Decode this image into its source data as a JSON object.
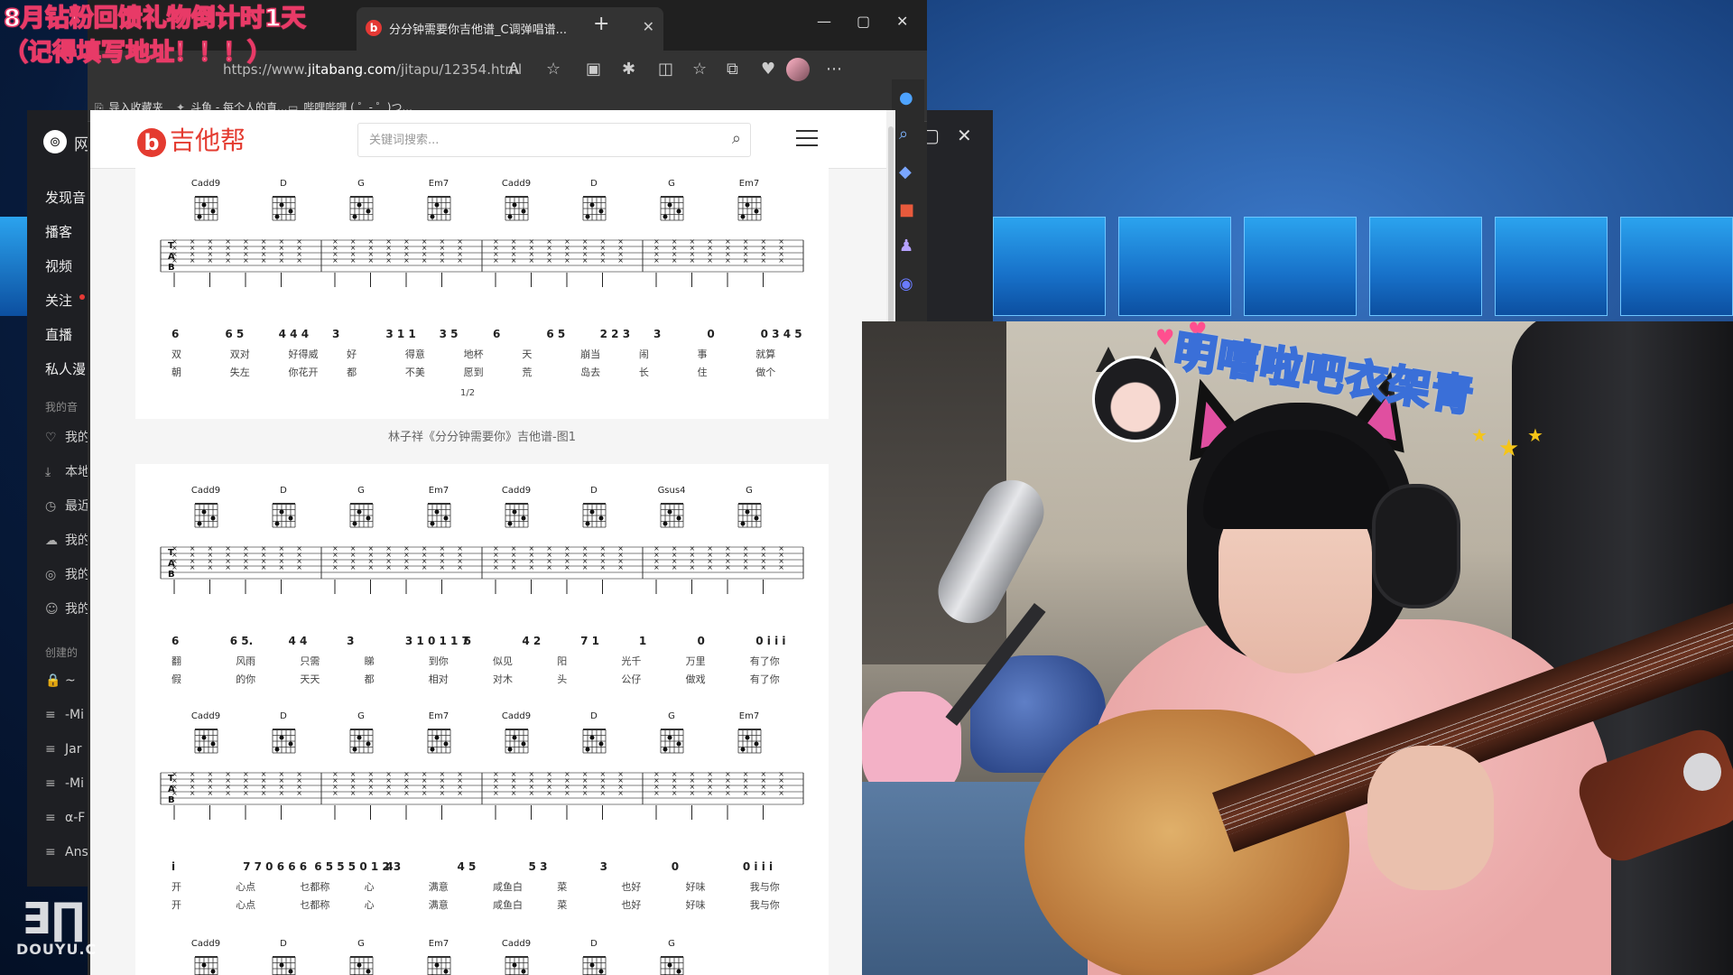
{
  "overlay": {
    "announce_line1": "8月钻粉回馈礼物倒计时1天",
    "announce_line2": "（记得填写地址！！！）",
    "streamer_label": "明嘻啦吧衣架青",
    "watermark": "DOUYU.C"
  },
  "browser": {
    "tab_title": "分分钟需要你吉他谱_C调弹唱谱...",
    "url_prefix": "https://www.",
    "url_host": "jitabang.com",
    "url_path": "/jitapu/12354.html",
    "favorites": [
      "导入收藏夹",
      "斗鱼 - 每个人的直...",
      "哔哩哔哩 ( ゜- ゜)つ..."
    ]
  },
  "site": {
    "logo_text": "吉他帮",
    "search_placeholder": "关键词搜索..."
  },
  "sheet1": {
    "chords": [
      "Cadd9",
      "D",
      "G",
      "Em7",
      "Cadd9",
      "D",
      "G",
      "Em7"
    ],
    "notes": [
      "6",
      "6 5",
      "4 4 4",
      "3",
      "3 1 1",
      "3 5",
      "6",
      "6 5",
      "2 2 3",
      "3",
      "0",
      "0 3 4 5"
    ],
    "lyrics1": "双 双对 好得威 好 得意 地杯 天 崩当 闹 事 就算",
    "lyrics2": "朝 失左 你花开 都 不美 愿到 荒 岛去 长 住 做个",
    "page_marker": "1/2",
    "caption": "林子祥《分分钟需要你》吉他谱-图1"
  },
  "sheet2": {
    "chords_row1": [
      "Cadd9",
      "D",
      "G",
      "Em7",
      "Cadd9",
      "D",
      "Gsus4",
      "G"
    ],
    "notes_row1": [
      "6",
      "6 5.",
      "4 4",
      "3",
      "3 1 0 1 1 7",
      "6",
      "4 2",
      "7 1",
      "1",
      "0",
      "0 i i i"
    ],
    "lyrics_row1a": "翻 风雨 只需 睇 到你 似见 阳 光千 万里 有了你",
    "lyrics_row1b": "假 的你 天天 都 相对 对木 头 公仔 做戏 有了你",
    "chords_row2": [
      "Cadd9",
      "D",
      "G",
      "Em7",
      "Cadd9",
      "D",
      "G",
      "Em7"
    ],
    "notes_row2": [
      "i",
      "7 7 0 6 6 6",
      "6 5 5 5 0 1 2 3",
      "4",
      "4 5",
      "5 3",
      "3",
      "0",
      "0 i i i"
    ],
    "lyrics_row2a": "开 心点 乜都称 心 满意 咸鱼白 菜 也好 好味 我与你",
    "lyrics_row2b": "开 心点 乜都称 心 满意 咸鱼白 菜 也好 好味 我与你",
    "chords_row3": [
      "Cadd9",
      "D",
      "G",
      "Em7",
      "Cadd9",
      "D",
      "G"
    ]
  },
  "music_app": {
    "title": "网",
    "nav": [
      "发现音",
      "播客",
      "视频",
      "关注",
      "直播",
      "私人漫"
    ],
    "section_mine": "我的音",
    "mine": [
      "我的",
      "本地",
      "最近",
      "我的",
      "我的",
      "我的"
    ],
    "section_created": "创建的",
    "playlists": [
      "~",
      "-Mi",
      "Jar",
      "-Mi",
      "α-F",
      "Ans"
    ]
  }
}
